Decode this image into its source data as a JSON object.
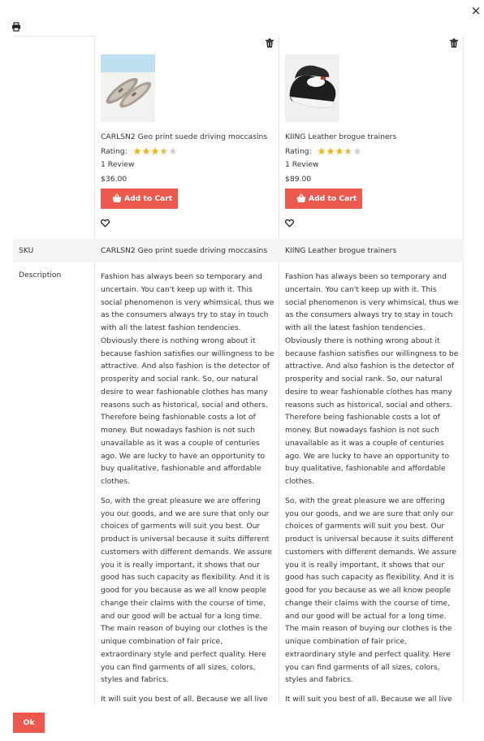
{
  "dialog": {
    "close_label": "×",
    "ok_label": "Ok"
  },
  "icons": {
    "close": "close-icon",
    "print": "print-icon",
    "delete": "trash-icon",
    "cart": "shopping-basket-icon",
    "wishlist": "heart-icon",
    "star": "star-icon"
  },
  "colors": {
    "accent": "#ed5a4d",
    "star_filled": "#f5b301",
    "star_empty": "#cccccc",
    "row_band": "#f4f4f4",
    "border": "#e6e6e6"
  },
  "rows": {
    "sku_label": "SKU",
    "description_label": "Description"
  },
  "products": [
    {
      "name": "CARLSN2 Geo print suede driving moccasins",
      "rating_label": "Rating:",
      "rating": 3.5,
      "rating_max": 5,
      "reviews": "1 Review",
      "price": "$36.00",
      "add_to_cart": "Add to Cart",
      "sku": "CARLSN2 Geo print suede driving moccasins",
      "image": "grey suede driving moccasins on light blue background",
      "description": [
        "Fashion has always been so temporary and uncertain. You can't keep up with it. This social phenomenon is very whimsical, thus we as the consumers always try to stay in touch with all the latest fashion tendencies. Obviously there is nothing wrong about it because fashion satisfies our willingness to be attractive. And also fashion is the detector of prosperity and social rank. So, our natural desire to wear fashionable clothes has many reasons such as historical, social and others. Therefore being fashionable costs a lot of money. But nowadays fashion is not such unavailable as it was a couple of centuries ago. We are lucky to have an opportunity to buy qualitative, fashionable and affordable clothes.",
        "So, with the great pleasure we are offering you our goods, and we are sure that only our choices of garments will suit you best. Our product is universal because it suits different customers with different demands. We assure you it is really important, it shows that our good has such capacity as flexibility. And it is good for you because as we all know people change their claims with the course of time, and our good will be actual for a long time. The main reason of buying our clothes is the unique combination of fair price, extraordinary style and perfect quality. Here you can find garments of all sizes, colors, styles and fabrics.",
        "It will suit you best of all. Because we all live in the time of total consuming of uncountable goods and services, and this has become the main reason for the rapid growth of a so-called"
      ]
    },
    {
      "name": "KIING Leather brogue trainers",
      "rating_label": "Rating:",
      "rating": 3.5,
      "rating_max": 5,
      "reviews": "1 Review",
      "price": "$89.00",
      "add_to_cart": "Add to Cart",
      "sku": "KIING Leather brogue trainers",
      "image": "black leather brogue trainers",
      "description": [
        "Fashion has always been so temporary and uncertain. You can't keep up with it. This social phenomenon is very whimsical, thus we as the consumers always try to stay in touch with all the latest fashion tendencies. Obviously there is nothing wrong about it because fashion satisfies our willingness to be attractive. And also fashion is the detector of prosperity and social rank. So, our natural desire to wear fashionable clothes has many reasons such as historical, social and others. Therefore being fashionable costs a lot of money. But nowadays fashion is not such unavailable as it was a couple of centuries ago. We are lucky to have an opportunity to buy qualitative, fashionable and affordable clothes.",
        "So, with the great pleasure we are offering you our goods, and we are sure that only our choices of garments will suit you best. Our product is universal because it suits different customers with different demands. We assure you it is really important, it shows that our good has such capacity as flexibility. And it is good for you because as we all know people change their claims with the course of time, and our good will be actual for a long time. The main reason of buying our clothes is the unique combination of fair price, extraordinary style and perfect quality. Here you can find garments of all sizes, colors, styles and fabrics.",
        "It will suit you best of all. Because we all live in the time of total consuming of uncountable goods and services, and this has become the main reason for the rapid growth of a so-called"
      ]
    }
  ]
}
